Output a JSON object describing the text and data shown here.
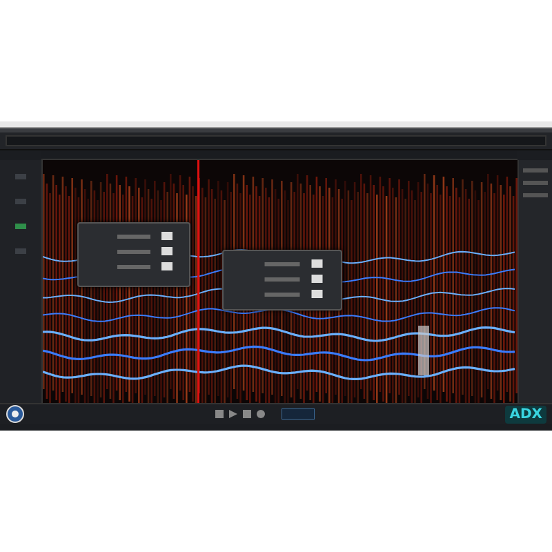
{
  "badge": {
    "text": "ADX"
  }
}
